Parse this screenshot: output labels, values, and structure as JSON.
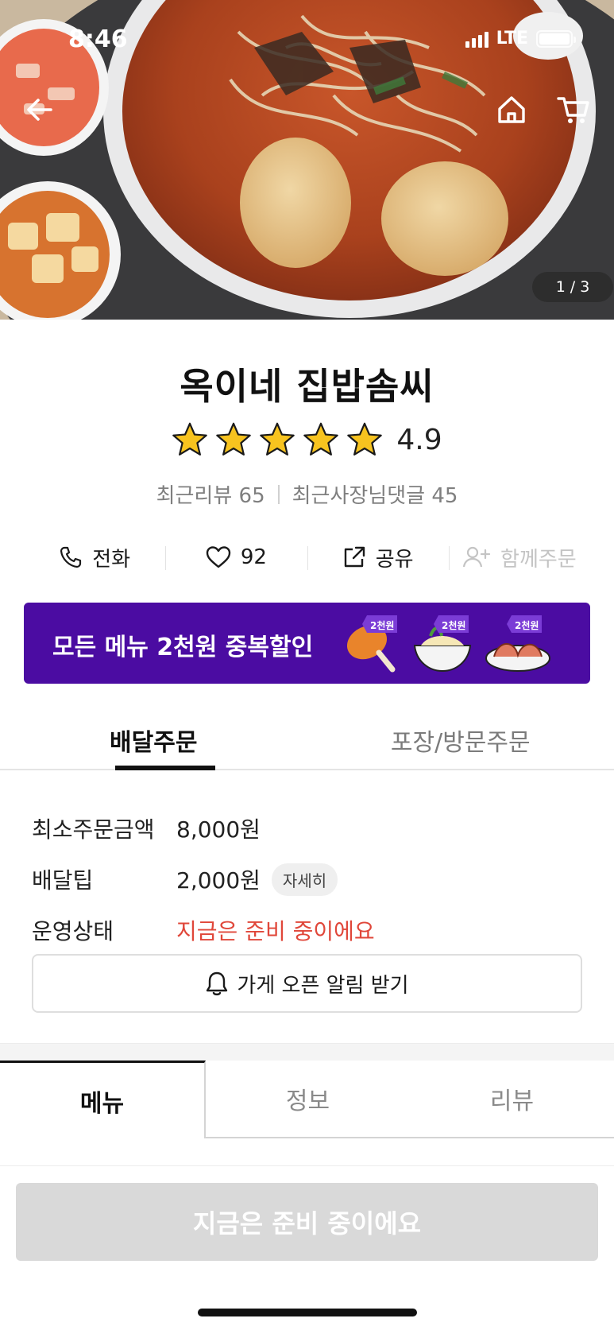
{
  "status_bar": {
    "time": "8:46",
    "network": "LTE"
  },
  "header": {
    "back_icon": "arrow-left-icon",
    "home_icon": "home-icon",
    "cart_icon": "cart-icon",
    "image_counter": {
      "current": "1",
      "separator": "/",
      "total": "3"
    }
  },
  "store": {
    "name": "옥이네 집밥솜씨",
    "rating": "4.9",
    "stars": 5,
    "recent_reviews": "최근리뷰 65",
    "owner_replies": "최근사장님댓글 45"
  },
  "actions": {
    "call": "전화",
    "likes": "92",
    "share": "공유",
    "group_order": "함께주문"
  },
  "promo": {
    "text": "모든 메뉴 2천원 중복할인",
    "badge": "2천원",
    "background": "#4b0ca2"
  },
  "order_tabs": [
    "배달주문",
    "포장/방문주문"
  ],
  "info": {
    "min_order_label": "최소주문금액",
    "min_order_value": "8,000원",
    "delivery_tip_label": "배달팁",
    "delivery_tip_value": "2,000원",
    "detail_label": "자세히",
    "status_label": "운영상태",
    "status_value": "지금은 준비 중이에요",
    "status_color": "#e0473a"
  },
  "alarm_button": "가게 오픈 알림 받기",
  "section_tabs": [
    "메뉴",
    "정보",
    "리뷰"
  ],
  "cta": "지금은 준비 중이에요"
}
